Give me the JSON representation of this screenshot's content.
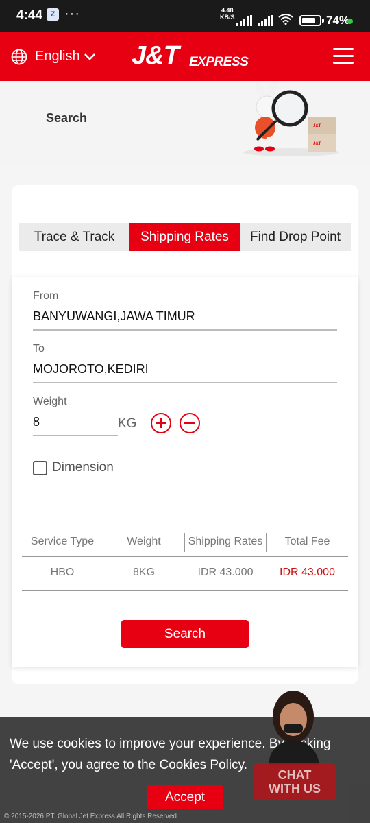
{
  "status_bar": {
    "time": "4:44",
    "speed_value": "4.48",
    "speed_unit": "KB/S",
    "battery": "74",
    "battery_suffix": "%"
  },
  "header": {
    "language": "English",
    "logo_main": "J&T",
    "logo_sub": "EXPRESS",
    "brand_color": "#e60012"
  },
  "banner": {
    "title": "Search"
  },
  "tabs": [
    {
      "label": "Trace & Track",
      "active": false
    },
    {
      "label": "Shipping Rates",
      "active": true
    },
    {
      "label": "Find Drop Point",
      "active": false
    }
  ],
  "form": {
    "from_label": "From",
    "from_value": "BANYUWANGI,JAWA TIMUR",
    "to_label": "To",
    "to_value": "MOJOROTO,KEDIRI",
    "weight_label": "Weight",
    "weight_value": "8",
    "weight_unit": "KG",
    "dimension_label": "Dimension",
    "dimension_checked": false
  },
  "rates_table": {
    "headers": [
      "Service Type",
      "Weight",
      "Shipping Rates",
      "Total Fee"
    ],
    "rows": [
      [
        "HBO",
        "8KG",
        "IDR 43.000",
        "IDR 43.000"
      ]
    ]
  },
  "search_button": "Search",
  "cookie": {
    "text_before": "We use cookies to improve your experience. By clicking 'Accept', you agree to the ",
    "link": "Cookies Policy",
    "text_after": ".",
    "accept": "Accept",
    "copyright": "© 2015-2026 PT. Global Jet Express All Rights Reserved"
  },
  "chat": {
    "label_line1": "CHAT",
    "label_line2": "WITH US"
  }
}
